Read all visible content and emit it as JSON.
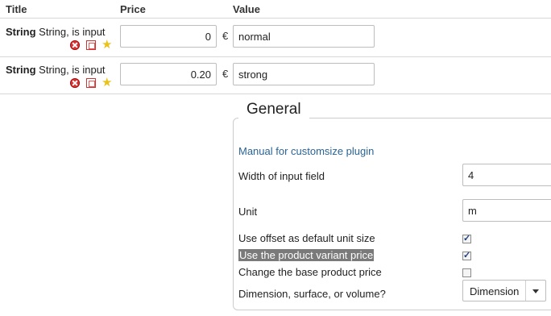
{
  "table": {
    "headers": {
      "title": "Title",
      "price": "Price",
      "value": "Value"
    },
    "rows": [
      {
        "title_bold": "String",
        "title_rest": " String, is input",
        "price": "0",
        "currency": "€",
        "value": "normal"
      },
      {
        "title_bold": "String",
        "title_rest": " String, is input",
        "price": "0.20",
        "currency": "€",
        "value": "strong"
      }
    ]
  },
  "general": {
    "legend": "General",
    "manual_link": "Manual for customsize plugin",
    "width_label": "Width of input field",
    "width_value": "4",
    "unit_label": "Unit",
    "unit_value": "m",
    "offset_label": "Use offset as default unit size",
    "offset_checked": true,
    "variant_label": "Use the product variant price",
    "variant_checked": true,
    "base_label": "Change the base product price",
    "base_checked": false,
    "dimension_label": "Dimension, surface, or volume?",
    "dimension_value": "Dimension"
  },
  "icons": [
    "delete-icon",
    "move-icon",
    "star-icon"
  ]
}
